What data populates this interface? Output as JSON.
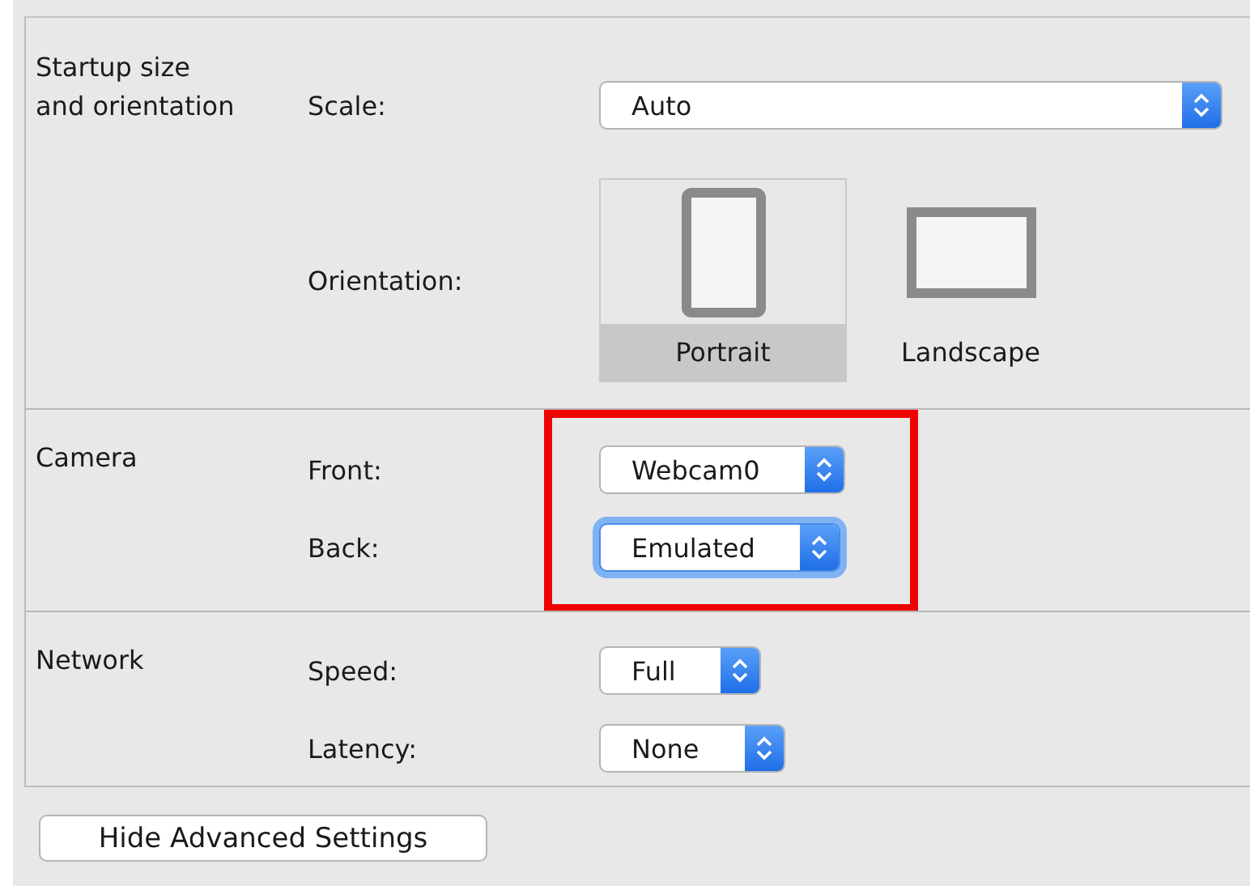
{
  "sections": [
    {
      "title": "Startup size and orientation",
      "highlighted": false,
      "rows": [
        {
          "kind": "select-wide",
          "label": "Scale:",
          "value": "Auto",
          "focused": false
        },
        {
          "kind": "orientation",
          "label": "Orientation:",
          "options": [
            {
              "label": "Portrait",
              "kind": "portrait",
              "selected": true
            },
            {
              "label": "Landscape",
              "kind": "landscape",
              "selected": false
            }
          ]
        }
      ]
    },
    {
      "title": "Camera",
      "highlighted": true,
      "rows": [
        {
          "kind": "select",
          "label": "Front:",
          "value": "Webcam0",
          "focused": false
        },
        {
          "kind": "select",
          "label": "Back:",
          "value": "Emulated",
          "focused": true
        }
      ]
    },
    {
      "title": "Network",
      "highlighted": false,
      "rows": [
        {
          "kind": "select",
          "label": "Speed:",
          "value": "Full",
          "focused": false
        },
        {
          "kind": "select",
          "label": "Latency:",
          "value": "None",
          "focused": false
        }
      ]
    }
  ],
  "button": "Hide Advanced Settings"
}
